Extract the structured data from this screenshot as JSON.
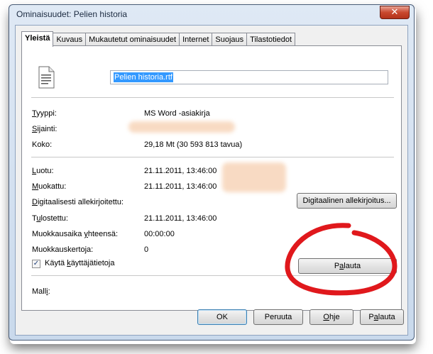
{
  "window": {
    "title": "Ominaisuudet: Pelien historia",
    "close_label": "✕"
  },
  "tabs": [
    "Yleistä",
    "Kuvaus",
    "Mukautetut ominaisuudet",
    "Internet",
    "Suojaus",
    "Tilastotiedot"
  ],
  "file": {
    "name": "Pelien historia.rtf"
  },
  "props": {
    "type_label": "Tyyppi:",
    "type_value": "MS Word -asiakirja",
    "location_label": "Sijainti:",
    "size_label": "Koko:",
    "size_value": "29,18 Mt (30 593 813 tavua)",
    "created_label": "Luotu:",
    "created_value": "21.11.2011, 13:46:00",
    "modified_label": "Muokattu:",
    "modified_value": "21.11.2011, 13:46:00",
    "signed_label": "Digitaalisesti allekirjoitettu:",
    "printed_label": "Tulostettu:",
    "printed_value": "21.11.2011, 13:46:00",
    "edit_time_label": "Muokkausaika yhteensä:",
    "edit_time_value": "00:00:00",
    "revisions_label": "Muokkauskertoja:",
    "revisions_value": "0",
    "template_label": "Malli:"
  },
  "checkbox": {
    "label": "Käytä käyttäjätietoja",
    "checked": true
  },
  "buttons": {
    "signature": "Digitaalinen allekirjoitus...",
    "reset": "Palauta",
    "ok": "OK",
    "cancel": "Peruuta",
    "help": "Ohje",
    "apply": "Palauta"
  },
  "colors": {
    "annotation": "#e0181c",
    "selection": "#3399ff",
    "redaction": "#f8d9c0"
  }
}
